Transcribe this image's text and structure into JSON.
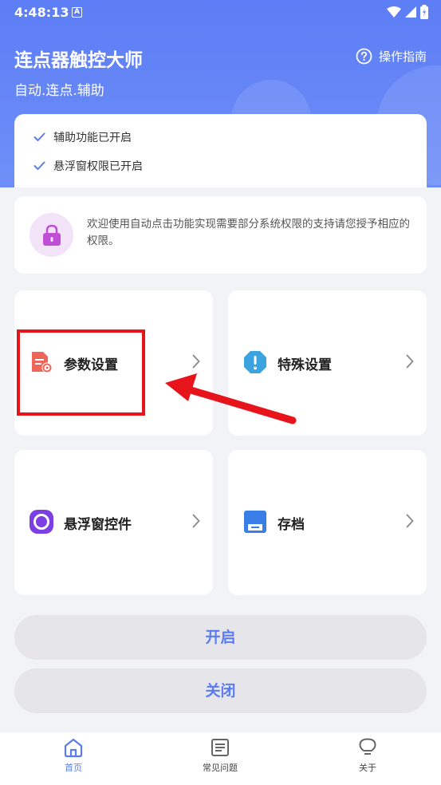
{
  "status_bar": {
    "time": "4:48:13",
    "notification_letter": "A"
  },
  "header": {
    "title": "连点器触控大师",
    "subtitle": "自动.连点.辅助",
    "guide_label": "操作指南"
  },
  "permissions": {
    "items": [
      "辅助功能已开启",
      "悬浮窗权限已开启"
    ]
  },
  "welcome": {
    "text": "欢迎使用自动点击功能实现需要部分系统权限的支持请您授予相应的权限。"
  },
  "tiles": {
    "params": "参数设置",
    "special": "特殊设置",
    "float_control": "悬浮窗控件",
    "archive": "存档"
  },
  "buttons": {
    "start": "开启",
    "close": "关闭"
  },
  "nav": {
    "home": "首页",
    "faq": "常见问题",
    "about": "关于"
  },
  "colors": {
    "accent": "#5a7cf0",
    "header": "#6385f6",
    "highlight": "#e8141c"
  }
}
